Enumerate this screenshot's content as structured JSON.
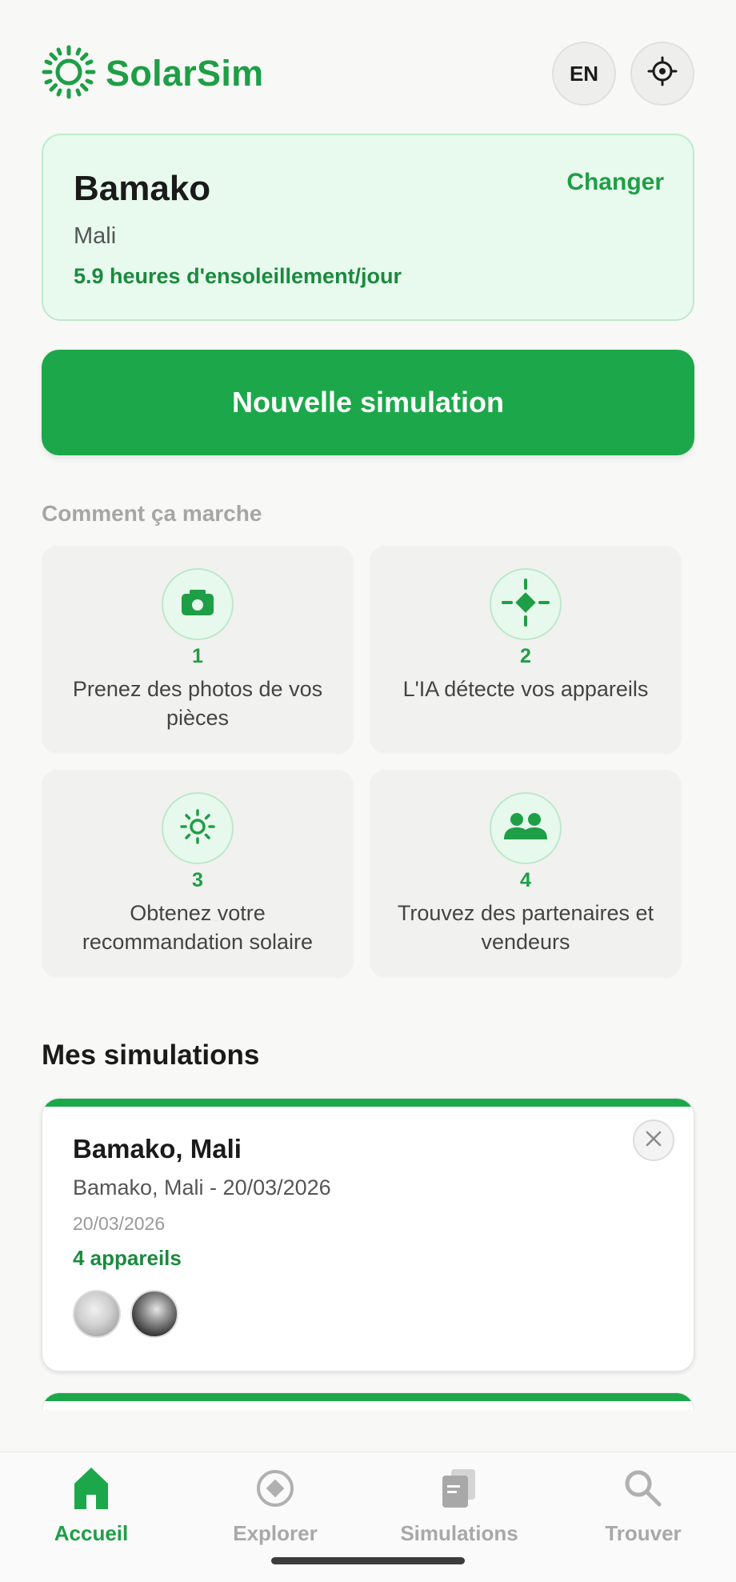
{
  "app": {
    "name": "SolarSim",
    "language_button": "EN",
    "accent_color": "#1ca84a"
  },
  "location": {
    "city": "Bamako",
    "country": "Mali",
    "sunshine": "5.9 heures d'ensoleillement/jour",
    "change_label": "Changer"
  },
  "new_simulation_label": "Nouvelle simulation",
  "how_it_works": {
    "title": "Comment ça marche",
    "steps": [
      {
        "number": "1",
        "text": "Prenez des photos de vos pièces",
        "icon": "camera-icon"
      },
      {
        "number": "2",
        "text": "L'IA détecte vos appareils",
        "icon": "target-icon"
      },
      {
        "number": "3",
        "text": "Obtenez votre recommandation solaire",
        "icon": "sun-icon"
      },
      {
        "number": "4",
        "text": "Trouvez des partenaires et vendeurs",
        "icon": "people-icon"
      }
    ]
  },
  "my_simulations": {
    "title": "Mes simulations",
    "items": [
      {
        "title": "Bamako, Mali",
        "subtitle": "Bamako, Mali - 20/03/2026",
        "date": "20/03/2026",
        "count": "4 appareils"
      }
    ]
  },
  "nav": {
    "items": [
      {
        "label": "Accueil",
        "icon": "home-icon",
        "active": true
      },
      {
        "label": "Explorer",
        "icon": "compass-icon",
        "active": false
      },
      {
        "label": "Simulations",
        "icon": "documents-icon",
        "active": false
      },
      {
        "label": "Trouver",
        "icon": "search-icon",
        "active": false
      }
    ]
  }
}
